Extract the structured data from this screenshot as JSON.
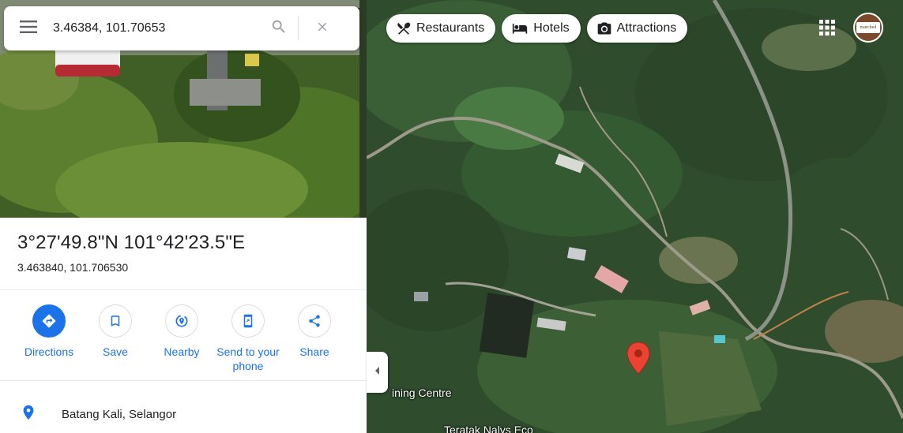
{
  "search": {
    "value": "3.46384, 101.70653",
    "menu_icon": "hamburger-menu-icon",
    "search_icon": "search-icon",
    "clear_icon": "close-icon"
  },
  "place": {
    "title": "3°27'49.8\"N 101°42'23.5\"E",
    "decimal": "3.463840, 101.706530",
    "address": "Batang Kali, Selangor"
  },
  "actions": [
    {
      "label": "Directions",
      "icon": "directions-icon"
    },
    {
      "label": "Save",
      "icon": "bookmark-icon"
    },
    {
      "label": "Nearby",
      "icon": "nearby-icon"
    },
    {
      "label": "Send to your phone",
      "icon": "send-to-phone-icon"
    },
    {
      "label": "Share",
      "icon": "share-icon"
    }
  ],
  "chips": [
    {
      "label": "Restaurants",
      "icon": "fork-knife-icon"
    },
    {
      "label": "Hotels",
      "icon": "bed-icon"
    },
    {
      "label": "Attractions",
      "icon": "camera-icon"
    }
  ],
  "map_labels": {
    "training_centre": "ining Centre",
    "teratak": "Teratak Nalys Eco"
  },
  "avatar_text": "marched",
  "colors": {
    "accent": "#1a73e8",
    "pin": "#ea4335",
    "text": "#202124"
  }
}
